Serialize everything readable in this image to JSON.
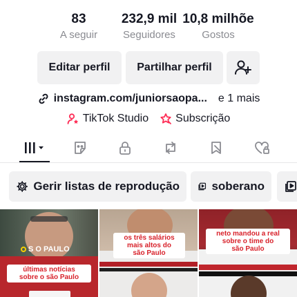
{
  "stats": [
    {
      "value": "83",
      "label": "A seguir"
    },
    {
      "value": "232,9 mil",
      "label": "Seguidores"
    },
    {
      "value": "10,8 milhõe",
      "label": "Gostos"
    }
  ],
  "actions": {
    "edit_label": "Editar perfil",
    "share_label": "Partilhar perfil"
  },
  "link": {
    "url": "instagram.com/juniorsaopa...",
    "more": "e 1 mais"
  },
  "tools": {
    "studio": "TikTok Studio",
    "subscription": "Subscrição"
  },
  "chips": {
    "playlists": "Gerir listas de reprodução",
    "soberano": "soberano"
  },
  "videos": [
    {
      "brand": "S O PAULO",
      "caption_line1": "últimas notícias",
      "caption_line2": "sobre o são Paulo"
    },
    {
      "caption_line1": "os três salários",
      "caption_line2": "mais altos do",
      "caption_line3": "são Paulo"
    },
    {
      "caption_line1": "neto mandou a real",
      "caption_line2": "sobre o time do",
      "caption_line3": "são Paulo"
    }
  ],
  "colors": {
    "text": "#161823",
    "muted": "#8a8b91",
    "button_bg": "#f1f1f2",
    "accent_pink": "#fe2c55",
    "caption_red": "#d8222b"
  }
}
